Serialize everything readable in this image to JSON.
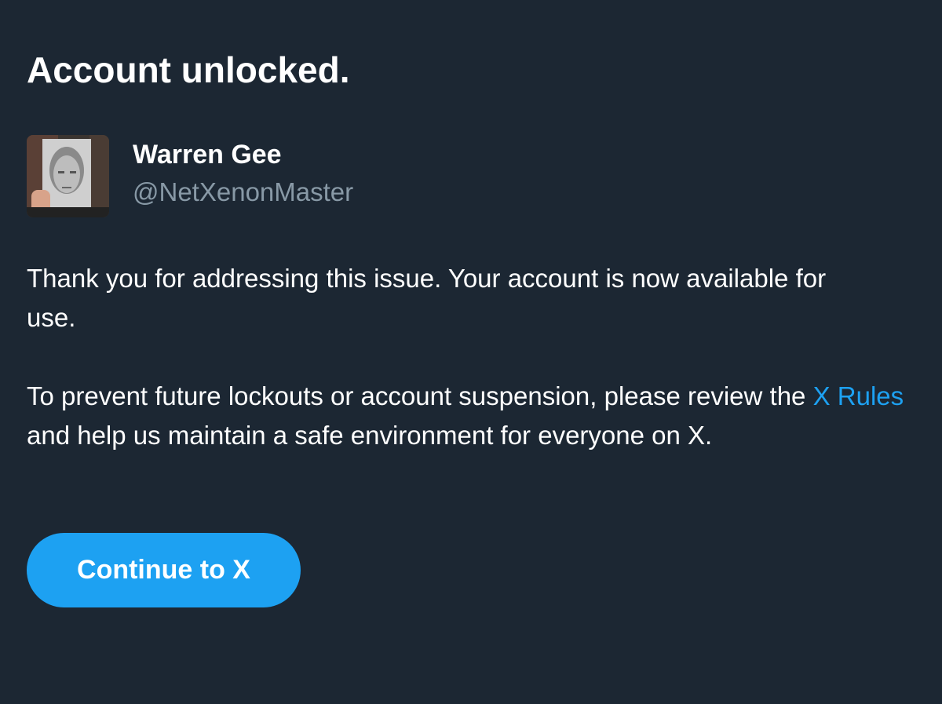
{
  "title": "Account unlocked.",
  "user": {
    "name": "Warren Gee",
    "handle": "@NetXenonMaster",
    "avatar_icon": "user-avatar-photo"
  },
  "message": {
    "paragraph1": "Thank you for addressing this issue. Your account is now available for use.",
    "paragraph2_before": "To prevent future lockouts or account suspension, please review the",
    "rules_link": "X Rules",
    "paragraph2_after": "and help us maintain a safe environment for everyone on X."
  },
  "continue_label": "Continue to X",
  "colors": {
    "background": "#1c2733",
    "accent": "#1da1f2",
    "secondary_text": "#8899a6",
    "primary_text": "#ffffff"
  }
}
